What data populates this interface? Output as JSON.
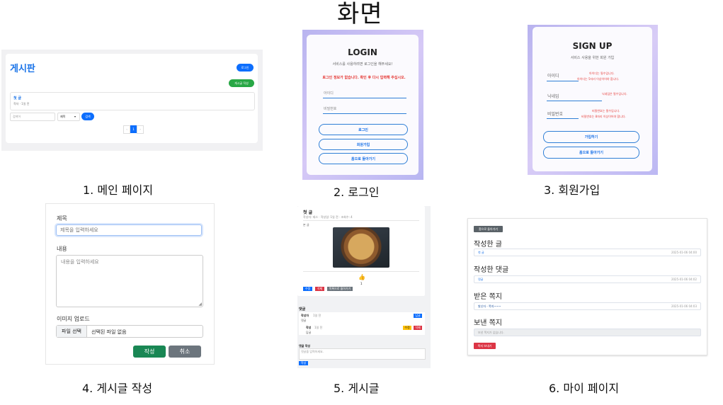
{
  "title": "화면",
  "captions": [
    "1. 메인 페이지",
    "2. 로그인",
    "3. 회원가입",
    "4. 게시글 작성",
    "5. 게시글",
    "6. 마이 페이지"
  ],
  "colors": {
    "primary": "#0d6efd",
    "success": "#28a745",
    "danger": "#dc3545",
    "gradient": "#c6bff4"
  },
  "main": {
    "board_title": "게시판",
    "login_button": "로그인",
    "write_button": "게시글 작성",
    "post_title": "첫 글",
    "post_meta": "작자 · 1일 전",
    "search_placeholder": "검색어",
    "search_select": "제목",
    "search_button": "검색",
    "pagination": [
      "‹",
      "1",
      "›"
    ]
  },
  "login": {
    "heading": "LOGIN",
    "subtitle": "서비스를 사용하려면 로그인을 해주세요!",
    "error": "로그인 정보가 없습니다. 확인 후 다시 입력해 주십시오.",
    "id_placeholder": "아이디",
    "pw_placeholder": "비밀번호",
    "login_button": "로그인",
    "signup_button": "회원가입",
    "home_button": "홈으로 돌아가기"
  },
  "signup": {
    "heading": "SIGN UP",
    "subtitle": "서비스 사용을 위한 회원 가입",
    "id_label": "아이디",
    "id_error1": "아이디는 필수입니다.",
    "id_error2": "아이디는 5자리 이상이어야 합니다.",
    "nick_label": "닉네임",
    "nick_error": "닉네임은 필수입니다.",
    "pw_label": "비밀번호",
    "pw_error1": "비밀번호는 필수입니다.",
    "pw_error2": "비밀번호는 8자리 이상이어야 합니다.",
    "join_button": "가입하기",
    "home_button": "홈으로 돌아가기"
  },
  "write": {
    "title_label": "제목",
    "title_placeholder": "제목을 입력하세요",
    "content_label": "내용",
    "content_placeholder": "내용을 입력하세요",
    "image_label": "이미지 업로드",
    "file_button": "파일 선택",
    "file_status": "선택된 파일 없음",
    "submit_button": "작성",
    "cancel_button": "취소"
  },
  "post": {
    "title": "첫 글",
    "meta": "작성자: 테스 · 작성일: 1일 전 · 조회수: 4",
    "body": "본 글",
    "like_icon": "thumbs-up-icon",
    "like_count": "1",
    "edit_button": "수정",
    "delete_button": "삭제",
    "list_button": "목록으로 돌아가기",
    "comments_label": "댓글",
    "comment1_author": "작성자",
    "comment1_time": "1일 전",
    "comment1_text": "댓글",
    "comment1_button": "답글",
    "reply_author": "작성",
    "reply_time": "1일 전",
    "reply_text": "답글",
    "reply_edit": "수정",
    "reply_delete": "삭제",
    "write_comment_label": "댓글 작성",
    "comment_placeholder": "댓글을 입력하세요.",
    "comment_submit": "작성"
  },
  "mypage": {
    "back_button": "홈으로 돌아가기",
    "my_posts": "작성한 글",
    "post_item": "첫 글",
    "post_date": "2025-01-06 04:00",
    "my_comments": "작성한 댓글",
    "comment_item": "댓글",
    "comment_date": "2025-01-06 04:02",
    "received": "받은 쪽지",
    "received_item": "발신자 - 쪽지~~~",
    "received_date": "2025-01-06 04:03",
    "sent": "보낸 쪽지",
    "sent_empty": "보낸 쪽지가 없습니다.",
    "send_button": "쪽지 보내기"
  }
}
